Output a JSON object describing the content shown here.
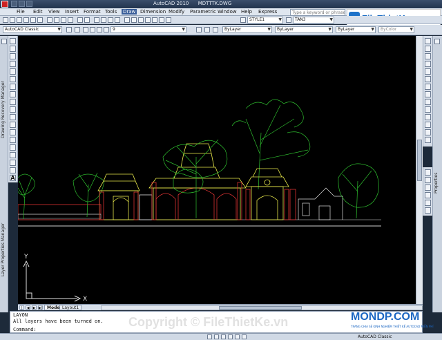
{
  "window": {
    "app_title": "AutoCAD 2010",
    "file_name": "MDTTTK.DWG",
    "search_placeholder": "Type a keyword or phrase"
  },
  "menu": {
    "items": [
      "File",
      "Edit",
      "View",
      "Insert",
      "Format",
      "Tools",
      "Draw",
      "Dimension",
      "Modify",
      "Parametric",
      "Window",
      "Help",
      "Express"
    ],
    "active": "Draw"
  },
  "toolbar1": {
    "text_style": "STYLE1",
    "dim_style": "TAN3"
  },
  "toolbar2": {
    "workspace": "AutoCAD Classic",
    "layer_current": "9",
    "color": "ByLayer",
    "linetype": "ByLayer",
    "lineweight": "ByLayer",
    "plotstyle": "ByColor"
  },
  "logo": {
    "text": "FileThietKe.vn"
  },
  "left_panels": {
    "drawing_recovery": "Drawing Recovery Manager",
    "layer_properties": "Layer Properties Manager"
  },
  "right_panel": {
    "properties": "Properties"
  },
  "layout_tabs": {
    "model": "Model",
    "layout1": "Layout1"
  },
  "ucs": {
    "x_label": "X",
    "y_label": "Y"
  },
  "command_line": {
    "line1": "LAYON",
    "line2": "All layers have been turned on.",
    "prompt": "Command:"
  },
  "statusbar": {
    "workspace": "AutoCAD Classic"
  },
  "watermark": {
    "copyright": "Copyright © FileThietKe.vn",
    "brand": "MONDP.COM",
    "brand_tagline": "TRANG CHIA SẺ KINH NGHIỆM THIẾT KẾ AUTOCAD MIỄN PHÍ"
  },
  "colors": {
    "canvas_bg": "#000000",
    "title_bg": "#22344e",
    "accent": "#1d6ec4"
  }
}
